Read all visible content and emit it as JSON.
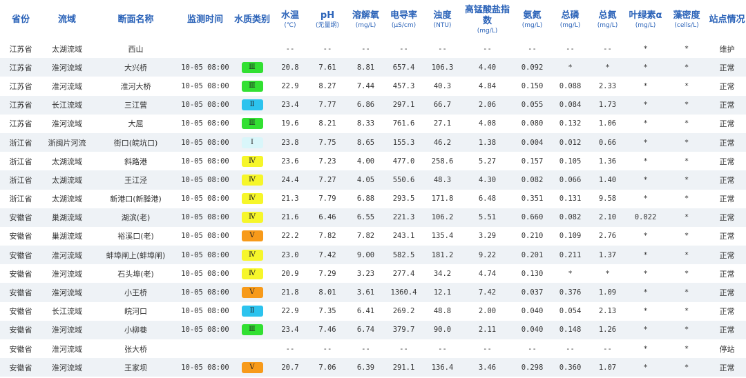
{
  "headers": [
    {
      "label": "省份",
      "unit": ""
    },
    {
      "label": "流域",
      "unit": ""
    },
    {
      "label": "断面名称",
      "unit": ""
    },
    {
      "label": "监测时间",
      "unit": ""
    },
    {
      "label": "水质类别",
      "unit": ""
    },
    {
      "label": "水温",
      "unit": "(℃)"
    },
    {
      "label": "pH",
      "unit": "(无量纲)"
    },
    {
      "label": "溶解氧",
      "unit": "(mg/L)"
    },
    {
      "label": "电导率",
      "unit": "(μS/cm)"
    },
    {
      "label": "浊度",
      "unit": "(NTU)"
    },
    {
      "label": "高锰酸盐指数",
      "unit": "(mg/L)"
    },
    {
      "label": "氨氮",
      "unit": "(mg/L)"
    },
    {
      "label": "总磷",
      "unit": "(mg/L)"
    },
    {
      "label": "总氮",
      "unit": "(mg/L)"
    },
    {
      "label": "叶绿素α",
      "unit": "(mg/L)"
    },
    {
      "label": "藻密度",
      "unit": "(cells/L)"
    },
    {
      "label": "站点情况",
      "unit": ""
    }
  ],
  "class_colors": {
    "I": "#d9f6fa",
    "II": "#2cc3ee",
    "III": "#32e032",
    "IV": "#f6f62a",
    "V": "#f79a1a"
  },
  "rows": [
    {
      "province": "江苏省",
      "basin": "太湖流域",
      "section": "西山",
      "time": "",
      "wq": "",
      "wq_class": "",
      "temp": "--",
      "ph": "--",
      "do": "--",
      "cond": "--",
      "turb": "--",
      "codmn": "--",
      "nh3": "--",
      "tp": "--",
      "tn": "--",
      "chla": "*",
      "algae": "*",
      "status": "维护"
    },
    {
      "province": "江苏省",
      "basin": "淮河流域",
      "section": "大兴桥",
      "time": "10-05 08:00",
      "wq": "Ⅲ",
      "wq_class": "III",
      "temp": "20.8",
      "ph": "7.61",
      "do": "8.81",
      "cond": "657.4",
      "turb": "106.3",
      "codmn": "4.40",
      "nh3": "0.092",
      "tp": "*",
      "tn": "*",
      "chla": "*",
      "algae": "*",
      "status": "正常"
    },
    {
      "province": "江苏省",
      "basin": "淮河流域",
      "section": "淮河大桥",
      "time": "10-05 08:00",
      "wq": "Ⅲ",
      "wq_class": "III",
      "temp": "22.9",
      "ph": "8.27",
      "do": "7.44",
      "cond": "457.3",
      "turb": "40.3",
      "codmn": "4.84",
      "nh3": "0.150",
      "tp": "0.088",
      "tn": "2.33",
      "chla": "*",
      "algae": "*",
      "status": "正常"
    },
    {
      "province": "江苏省",
      "basin": "长江流域",
      "section": "三江营",
      "time": "10-05 08:00",
      "wq": "Ⅱ",
      "wq_class": "II",
      "temp": "23.4",
      "ph": "7.77",
      "do": "6.86",
      "cond": "297.1",
      "turb": "66.7",
      "codmn": "2.06",
      "nh3": "0.055",
      "tp": "0.084",
      "tn": "1.73",
      "chla": "*",
      "algae": "*",
      "status": "正常"
    },
    {
      "province": "江苏省",
      "basin": "淮河流域",
      "section": "大屈",
      "time": "10-05 08:00",
      "wq": "Ⅲ",
      "wq_class": "III",
      "temp": "19.6",
      "ph": "8.21",
      "do": "8.33",
      "cond": "761.6",
      "turb": "27.1",
      "codmn": "4.08",
      "nh3": "0.080",
      "tp": "0.132",
      "tn": "1.06",
      "chla": "*",
      "algae": "*",
      "status": "正常"
    },
    {
      "province": "浙江省",
      "basin": "浙闽片河流",
      "section": "街口(皖坑口)",
      "time": "10-05 08:00",
      "wq": "Ⅰ",
      "wq_class": "I",
      "temp": "23.8",
      "ph": "7.75",
      "do": "8.65",
      "cond": "155.3",
      "turb": "46.2",
      "codmn": "1.38",
      "nh3": "0.004",
      "tp": "0.012",
      "tn": "0.66",
      "chla": "*",
      "algae": "*",
      "status": "正常"
    },
    {
      "province": "浙江省",
      "basin": "太湖流域",
      "section": "斜路港",
      "time": "10-05 08:00",
      "wq": "Ⅳ",
      "wq_class": "IV",
      "temp": "23.6",
      "ph": "7.23",
      "do": "4.00",
      "cond": "477.0",
      "turb": "258.6",
      "codmn": "5.27",
      "nh3": "0.157",
      "tp": "0.105",
      "tn": "1.36",
      "chla": "*",
      "algae": "*",
      "status": "正常"
    },
    {
      "province": "浙江省",
      "basin": "太湖流域",
      "section": "王江泾",
      "time": "10-05 08:00",
      "wq": "Ⅳ",
      "wq_class": "IV",
      "temp": "24.4",
      "ph": "7.27",
      "do": "4.05",
      "cond": "550.6",
      "turb": "48.3",
      "codmn": "4.30",
      "nh3": "0.082",
      "tp": "0.066",
      "tn": "1.40",
      "chla": "*",
      "algae": "*",
      "status": "正常"
    },
    {
      "province": "浙江省",
      "basin": "太湖流域",
      "section": "新港口(新塍港)",
      "time": "10-05 08:00",
      "wq": "Ⅳ",
      "wq_class": "IV",
      "temp": "21.3",
      "ph": "7.79",
      "do": "6.88",
      "cond": "293.5",
      "turb": "171.8",
      "codmn": "6.48",
      "nh3": "0.351",
      "tp": "0.131",
      "tn": "9.58",
      "chla": "*",
      "algae": "*",
      "status": "正常"
    },
    {
      "province": "安徽省",
      "basin": "巢湖流域",
      "section": "湖滨(老)",
      "time": "10-05 08:00",
      "wq": "Ⅳ",
      "wq_class": "IV",
      "temp": "21.6",
      "ph": "6.46",
      "do": "6.55",
      "cond": "221.3",
      "turb": "106.2",
      "codmn": "5.51",
      "nh3": "0.660",
      "tp": "0.082",
      "tn": "2.10",
      "chla": "0.022",
      "algae": "*",
      "status": "正常"
    },
    {
      "province": "安徽省",
      "basin": "巢湖流域",
      "section": "裕溪口(老)",
      "time": "10-05 08:00",
      "wq": "Ⅴ",
      "wq_class": "V",
      "temp": "22.2",
      "ph": "7.82",
      "do": "7.82",
      "cond": "243.1",
      "turb": "135.4",
      "codmn": "3.29",
      "nh3": "0.210",
      "tp": "0.109",
      "tn": "2.76",
      "chla": "*",
      "algae": "*",
      "status": "正常"
    },
    {
      "province": "安徽省",
      "basin": "淮河流域",
      "section": "蚌埠闸上(蚌埠闸)",
      "time": "10-05 08:00",
      "wq": "Ⅳ",
      "wq_class": "IV",
      "temp": "23.0",
      "ph": "7.42",
      "do": "9.00",
      "cond": "582.5",
      "turb": "181.2",
      "codmn": "9.22",
      "nh3": "0.201",
      "tp": "0.211",
      "tn": "1.37",
      "chla": "*",
      "algae": "*",
      "status": "正常"
    },
    {
      "province": "安徽省",
      "basin": "淮河流域",
      "section": "石头埠(老)",
      "time": "10-05 08:00",
      "wq": "Ⅳ",
      "wq_class": "IV",
      "temp": "20.9",
      "ph": "7.29",
      "do": "3.23",
      "cond": "277.4",
      "turb": "34.2",
      "codmn": "4.74",
      "nh3": "0.130",
      "tp": "*",
      "tn": "*",
      "chla": "*",
      "algae": "*",
      "status": "正常"
    },
    {
      "province": "安徽省",
      "basin": "淮河流域",
      "section": "小王桥",
      "time": "10-05 08:00",
      "wq": "Ⅴ",
      "wq_class": "V",
      "temp": "21.8",
      "ph": "8.01",
      "do": "3.61",
      "cond": "1360.4",
      "turb": "12.1",
      "codmn": "7.42",
      "nh3": "0.037",
      "tp": "0.376",
      "tn": "1.09",
      "chla": "*",
      "algae": "*",
      "status": "正常"
    },
    {
      "province": "安徽省",
      "basin": "长江流域",
      "section": "皖河口",
      "time": "10-05 08:00",
      "wq": "Ⅱ",
      "wq_class": "II",
      "temp": "22.9",
      "ph": "7.35",
      "do": "6.41",
      "cond": "269.2",
      "turb": "48.8",
      "codmn": "2.00",
      "nh3": "0.040",
      "tp": "0.054",
      "tn": "2.13",
      "chla": "*",
      "algae": "*",
      "status": "正常"
    },
    {
      "province": "安徽省",
      "basin": "淮河流域",
      "section": "小柳巷",
      "time": "10-05 08:00",
      "wq": "Ⅲ",
      "wq_class": "III",
      "temp": "23.4",
      "ph": "7.46",
      "do": "6.74",
      "cond": "379.7",
      "turb": "90.0",
      "codmn": "2.11",
      "nh3": "0.040",
      "tp": "0.148",
      "tn": "1.26",
      "chla": "*",
      "algae": "*",
      "status": "正常"
    },
    {
      "province": "安徽省",
      "basin": "淮河流域",
      "section": "张大桥",
      "time": "",
      "wq": "",
      "wq_class": "",
      "temp": "--",
      "ph": "--",
      "do": "--",
      "cond": "--",
      "turb": "--",
      "codmn": "--",
      "nh3": "--",
      "tp": "--",
      "tn": "--",
      "chla": "*",
      "algae": "*",
      "status": "停站"
    },
    {
      "province": "安徽省",
      "basin": "淮河流域",
      "section": "王家坝",
      "time": "10-05 08:00",
      "wq": "Ⅴ",
      "wq_class": "V",
      "temp": "20.7",
      "ph": "7.06",
      "do": "6.39",
      "cond": "291.1",
      "turb": "136.4",
      "codmn": "3.46",
      "nh3": "0.298",
      "tp": "0.360",
      "tn": "1.07",
      "chla": "*",
      "algae": "*",
      "status": "正常"
    }
  ]
}
